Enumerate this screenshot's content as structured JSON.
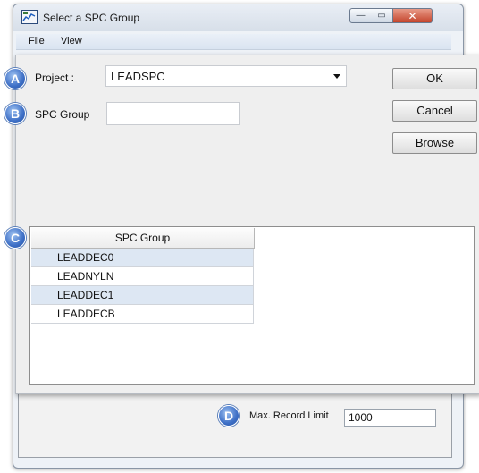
{
  "window": {
    "title": "Select a SPC Group",
    "min_glyph": "—",
    "max_glyph": "▭",
    "close_glyph": "✕",
    "menu": [
      "File",
      "View"
    ]
  },
  "form": {
    "project_label": "Project :",
    "project_value": "LEADSPC",
    "spc_group_label": "SPC Group",
    "spc_group_value": ""
  },
  "buttons": {
    "ok": "OK",
    "cancel": "Cancel",
    "browse": "Browse"
  },
  "grid": {
    "header": "SPC Group",
    "rows": [
      "LEADDEC0",
      "LEADNYLN",
      "LEADDEC1",
      "LEADDECB"
    ]
  },
  "limit": {
    "label": "Max. Record Limit",
    "value": "1000"
  },
  "callouts": {
    "a": "A",
    "b": "B",
    "c": "C",
    "d": "D"
  },
  "colors": {
    "badge": "#3d6fc6",
    "row_alt": "#dde7f3",
    "close_button": "#c4452c"
  }
}
